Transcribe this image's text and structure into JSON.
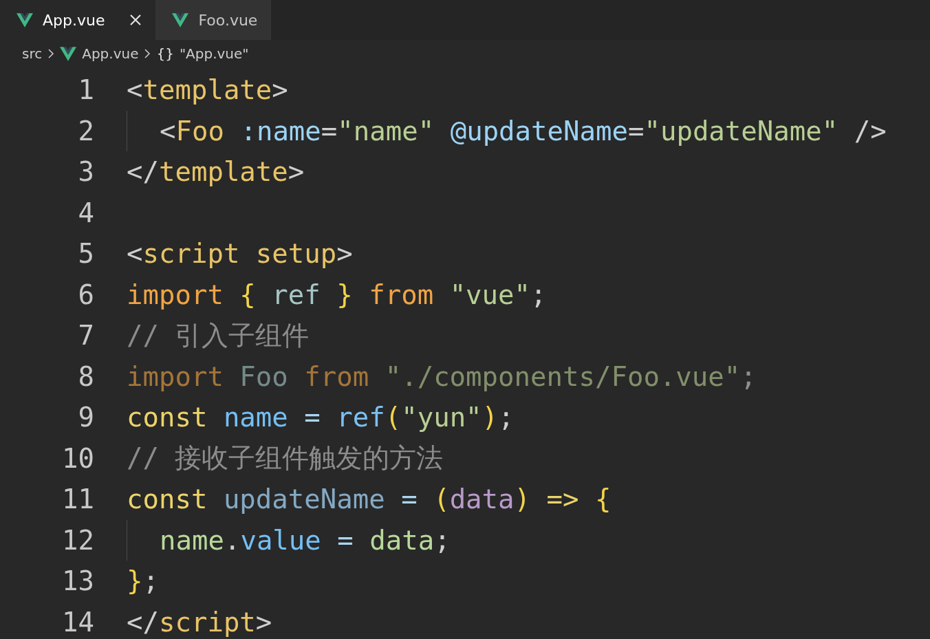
{
  "tabs": [
    {
      "label": "App.vue",
      "selected": true,
      "show_close": true
    },
    {
      "label": "Foo.vue",
      "selected": false,
      "show_close": false
    }
  ],
  "breadcrumb": [
    {
      "kind": "folder",
      "label": "src"
    },
    {
      "kind": "file",
      "label": "App.vue"
    },
    {
      "kind": "symbol",
      "glyph": "{}",
      "label": "\"App.vue\""
    }
  ],
  "lines": [
    {
      "number": "1",
      "indented": false,
      "faded": false,
      "tokens": [
        {
          "text": "<",
          "kind": "punct"
        },
        {
          "text": "template",
          "kind": "tag"
        },
        {
          "text": ">",
          "kind": "punct"
        }
      ]
    },
    {
      "number": "2",
      "indented": true,
      "faded": false,
      "tokens": [
        {
          "text": "<",
          "kind": "punct"
        },
        {
          "text": "Foo",
          "kind": "tag"
        },
        {
          "text": " :name",
          "kind": "attr"
        },
        {
          "text": "=",
          "kind": "punct"
        },
        {
          "text": "\"name\"",
          "kind": "string"
        },
        {
          "text": " @updateName",
          "kind": "attr"
        },
        {
          "text": "=",
          "kind": "punct"
        },
        {
          "text": "\"updateName\"",
          "kind": "string"
        },
        {
          "text": " />",
          "kind": "punct"
        }
      ]
    },
    {
      "number": "3",
      "indented": false,
      "faded": false,
      "tokens": [
        {
          "text": "</",
          "kind": "punct"
        },
        {
          "text": "template",
          "kind": "tag"
        },
        {
          "text": ">",
          "kind": "punct"
        }
      ]
    },
    {
      "number": "4",
      "indented": false
    },
    {
      "number": "5",
      "indented": false,
      "faded": false,
      "tokens": [
        {
          "text": "<",
          "kind": "punct"
        },
        {
          "text": "script",
          "kind": "tag"
        },
        {
          "text": " setup",
          "kind": "tag"
        },
        {
          "text": ">",
          "kind": "punct"
        }
      ]
    },
    {
      "number": "6",
      "indented": false,
      "faded": false,
      "tokens": [
        {
          "text": "import",
          "kind": "keyword"
        },
        {
          "text": " {",
          "kind": "brace"
        },
        {
          "text": " ref",
          "kind": "import"
        },
        {
          "text": " }",
          "kind": "brace"
        },
        {
          "text": " from",
          "kind": "keyword"
        },
        {
          "text": " \"vue\"",
          "kind": "string"
        },
        {
          "text": ";",
          "kind": "punct"
        }
      ]
    },
    {
      "number": "7",
      "indented": false,
      "faded": false,
      "tokens": [
        {
          "text": "// 引入子组件",
          "kind": "comment"
        }
      ]
    },
    {
      "number": "8",
      "indented": false,
      "faded": true,
      "tokens": [
        {
          "text": "import",
          "kind": "keyword"
        },
        {
          "text": " Foo",
          "kind": "import"
        },
        {
          "text": " from",
          "kind": "keyword"
        },
        {
          "text": " \"./components/Foo.vue\"",
          "kind": "string"
        },
        {
          "text": ";",
          "kind": "punct"
        }
      ]
    },
    {
      "number": "9",
      "indented": false,
      "faded": false,
      "tokens": [
        {
          "text": "const",
          "kind": "storage"
        },
        {
          "text": " name",
          "kind": "variable"
        },
        {
          "text": " =",
          "kind": "operator"
        },
        {
          "text": " ref",
          "kind": "function"
        },
        {
          "text": "(",
          "kind": "brace"
        },
        {
          "text": "\"yun\"",
          "kind": "string"
        },
        {
          "text": ")",
          "kind": "brace"
        },
        {
          "text": ";",
          "kind": "punct"
        }
      ]
    },
    {
      "number": "10",
      "indented": false,
      "faded": false,
      "tokens": [
        {
          "text": "// 接收子组件触发的方法",
          "kind": "comment"
        }
      ]
    },
    {
      "number": "11",
      "indented": false,
      "faded": false,
      "tokens": [
        {
          "text": "const",
          "kind": "storage"
        },
        {
          "text": " updateName",
          "kind": "function-name"
        },
        {
          "text": " =",
          "kind": "operator"
        },
        {
          "text": " (",
          "kind": "brace"
        },
        {
          "text": "data",
          "kind": "parameter"
        },
        {
          "text": ")",
          "kind": "brace"
        },
        {
          "text": " =>",
          "kind": "storage"
        },
        {
          "text": " {",
          "kind": "brace"
        }
      ]
    },
    {
      "number": "12",
      "indented": true,
      "faded": false,
      "tokens": [
        {
          "text": "name",
          "kind": "plain"
        },
        {
          "text": ".",
          "kind": "punct"
        },
        {
          "text": "value",
          "kind": "variable"
        },
        {
          "text": " =",
          "kind": "operator"
        },
        {
          "text": " data",
          "kind": "plain"
        },
        {
          "text": ";",
          "kind": "punct"
        }
      ]
    },
    {
      "number": "13",
      "indented": false,
      "faded": false,
      "tokens": [
        {
          "text": "}",
          "kind": "brace"
        },
        {
          "text": ";",
          "kind": "punct"
        }
      ]
    },
    {
      "number": "14",
      "indented": false,
      "faded": false,
      "tokens": [
        {
          "text": "</",
          "kind": "punct"
        },
        {
          "text": "script",
          "kind": "tag"
        },
        {
          "text": ">",
          "kind": "punct"
        }
      ]
    }
  ]
}
